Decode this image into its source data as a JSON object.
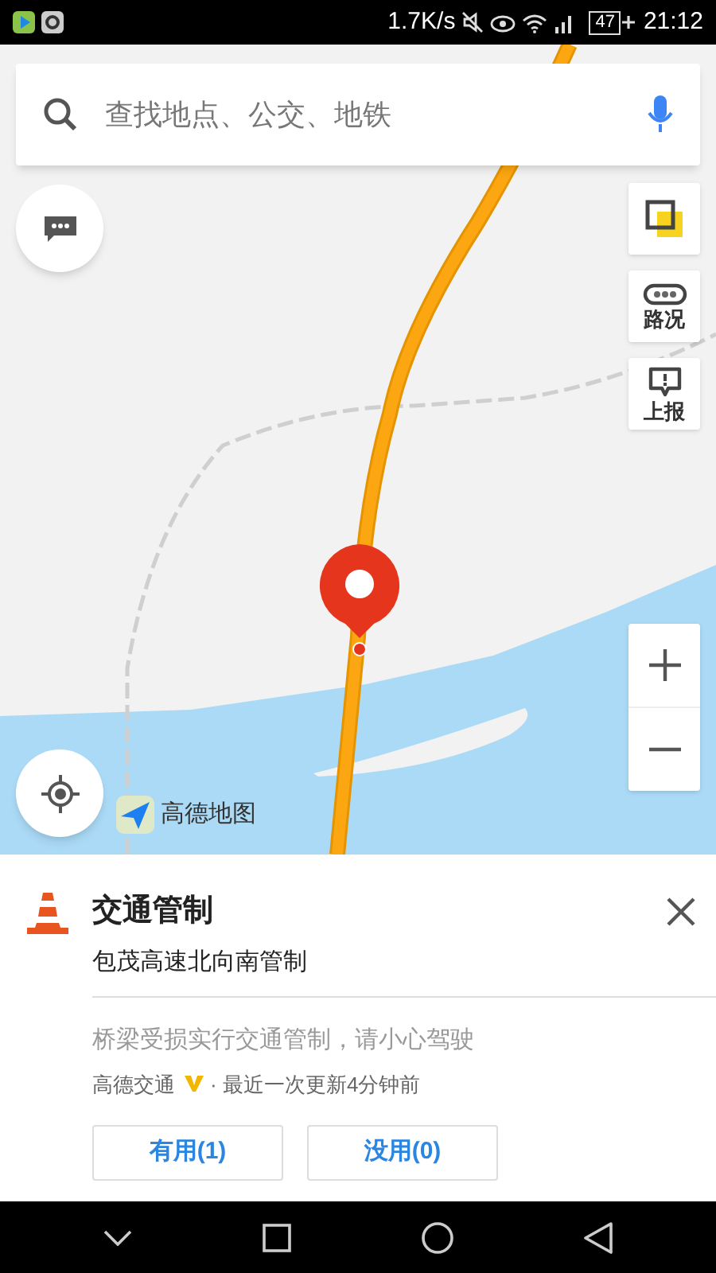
{
  "status_bar": {
    "net_speed": "1.7K/s",
    "battery": "47",
    "time": "21:12"
  },
  "search": {
    "placeholder": "查找地点、公交、地铁"
  },
  "map_controls": [
    {
      "kind": "layers"
    },
    {
      "kind": "traffic",
      "label": "路况"
    },
    {
      "kind": "report",
      "label": "上报"
    }
  ],
  "logo": "高德地图",
  "notice": {
    "title": "交通管制",
    "subtitle": "包茂高速北向南管制",
    "description": "桥梁受损实行交通管制，请小心驾驶",
    "source": "高德交通",
    "update": "· 最近一次更新4分钟前",
    "buttons": [
      "有用(1)",
      "没用(0)"
    ]
  }
}
